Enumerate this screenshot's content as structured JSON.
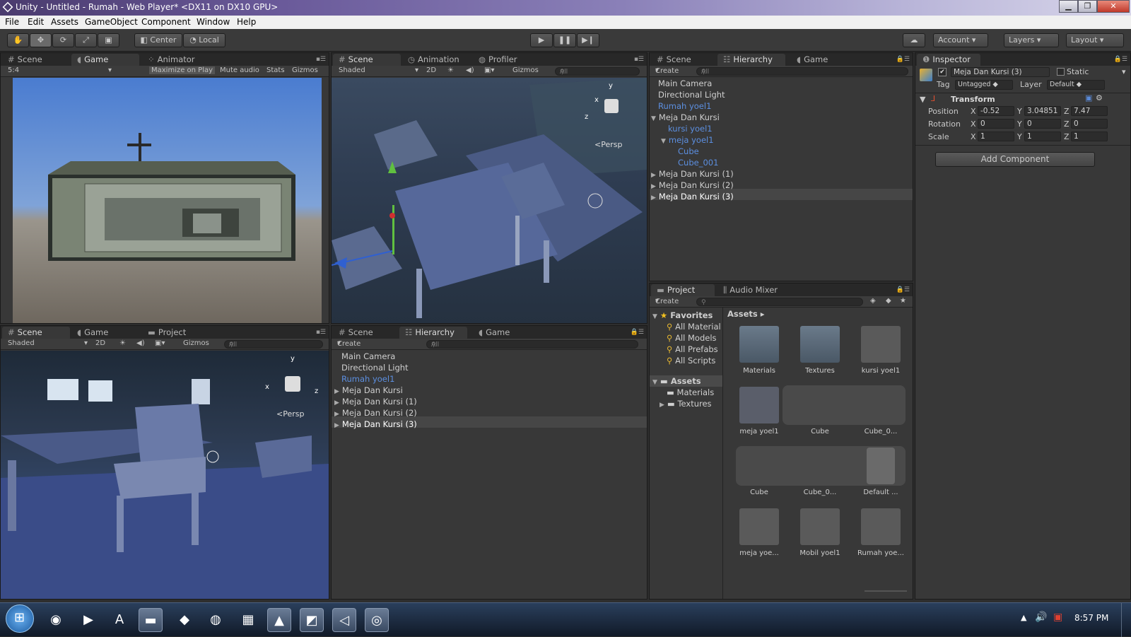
{
  "window": {
    "title": "Unity - Untitled - Rumah - Web Player* <DX11 on DX10 GPU>",
    "min": "▁",
    "max": "❐",
    "close": "✕"
  },
  "menu": [
    "File",
    "Edit",
    "Assets",
    "GameObject",
    "Component",
    "Window",
    "Help"
  ],
  "toolbar": {
    "pivot": "Center",
    "space": "Local",
    "account": "Account",
    "layers": "Layers",
    "layout": "Layout"
  },
  "game_panel": {
    "tabs": [
      "Scene",
      "Game",
      "Animator"
    ],
    "aspect": "5:4",
    "maximize": "Maximize on Play",
    "mute": "Mute audio",
    "stats": "Stats",
    "gizmos": "Gizmos"
  },
  "scene_top": {
    "tabs": [
      "Scene",
      "Animation",
      "Profiler"
    ],
    "shading": "Shaded",
    "mode2d": "2D",
    "gizmos": "Gizmos",
    "search": "All",
    "persp": "Persp",
    "axis_y": "y",
    "axis_x": "x",
    "axis_z": "z"
  },
  "hierarchy_top": {
    "tabs": [
      "Scene",
      "Hierarchy",
      "Game"
    ],
    "create": "Create",
    "search": "All",
    "items": [
      {
        "label": "Main Camera",
        "depth": 0,
        "arrow": "",
        "blue": false
      },
      {
        "label": "Directional Light",
        "depth": 0,
        "arrow": "",
        "blue": false
      },
      {
        "label": "Rumah yoel1",
        "depth": 0,
        "arrow": "",
        "blue": true
      },
      {
        "label": "Meja Dan Kursi",
        "depth": 0,
        "arrow": "▼",
        "blue": false
      },
      {
        "label": "kursi yoel1",
        "depth": 1,
        "arrow": "",
        "blue": true
      },
      {
        "label": "meja yoel1",
        "depth": 1,
        "arrow": "▼",
        "blue": true
      },
      {
        "label": "Cube",
        "depth": 2,
        "arrow": "",
        "blue": true
      },
      {
        "label": "Cube_001",
        "depth": 2,
        "arrow": "",
        "blue": true
      },
      {
        "label": "Meja Dan Kursi (1)",
        "depth": 0,
        "arrow": "▶",
        "blue": false
      },
      {
        "label": "Meja Dan Kursi (2)",
        "depth": 0,
        "arrow": "▶",
        "blue": false
      },
      {
        "label": "Meja Dan Kursi (3)",
        "depth": 0,
        "arrow": "▶",
        "blue": false,
        "selected": true
      }
    ]
  },
  "inspector": {
    "tab": "Inspector",
    "object_name": "Meja Dan Kursi (3)",
    "static": "Static",
    "tag_label": "Tag",
    "tag_value": "Untagged",
    "layer_label": "Layer",
    "layer_value": "Default",
    "transform": "Transform",
    "position_label": "Position",
    "rotation_label": "Rotation",
    "scale_label": "Scale",
    "position": {
      "x": "-0.52",
      "y": "3.04851",
      "z": "7.47"
    },
    "rotation": {
      "x": "0",
      "y": "0",
      "z": "0"
    },
    "scale": {
      "x": "1",
      "y": "1",
      "z": "1"
    },
    "axis_x": "X",
    "axis_y": "Y",
    "axis_z": "Z",
    "add_component": "Add Component"
  },
  "scene_bottom": {
    "tabs": [
      "Scene",
      "Game",
      "Project"
    ],
    "shading": "Shaded",
    "mode2d": "2D",
    "gizmos": "Gizmos",
    "search": "All",
    "persp": "Persp",
    "axis_y": "y",
    "axis_x": "x",
    "axis_z": "z"
  },
  "hierarchy_bottom": {
    "tabs": [
      "Scene",
      "Hierarchy",
      "Game"
    ],
    "create": "Create",
    "search": "All",
    "items": [
      {
        "label": "Main Camera",
        "arrow": "",
        "blue": false
      },
      {
        "label": "Directional Light",
        "arrow": "",
        "blue": false
      },
      {
        "label": "Rumah yoel1",
        "arrow": "",
        "blue": true
      },
      {
        "label": "Meja Dan Kursi",
        "arrow": "▶",
        "blue": false
      },
      {
        "label": "Meja Dan Kursi (1)",
        "arrow": "▶",
        "blue": false
      },
      {
        "label": "Meja Dan Kursi (2)",
        "arrow": "▶",
        "blue": false
      },
      {
        "label": "Meja Dan Kursi (3)",
        "arrow": "▶",
        "blue": false,
        "selected": true
      }
    ]
  },
  "project": {
    "tabs": [
      "Project",
      "Audio Mixer"
    ],
    "create": "Create",
    "favorites": "Favorites",
    "fav_items": [
      "All Material",
      "All Models",
      "All Prefabs",
      "All Scripts"
    ],
    "assets": "Assets",
    "folders": [
      "Materials",
      "Textures"
    ],
    "breadcrumb": "Assets",
    "grid": [
      {
        "label": "Materials",
        "kind": "folder"
      },
      {
        "label": "Textures",
        "kind": "folder"
      },
      {
        "label": "kursi yoel1",
        "kind": "model"
      },
      {
        "label": "meja yoel1",
        "kind": "model"
      },
      {
        "label": "Cube",
        "kind": "mesh"
      },
      {
        "label": "Cube_0...",
        "kind": "mesh"
      },
      {
        "label": "Cube",
        "kind": "mesh2"
      },
      {
        "label": "Cube_0...",
        "kind": "cube"
      },
      {
        "label": "Default ...",
        "kind": "anim"
      },
      {
        "label": "meja yoe...",
        "kind": "avatar"
      },
      {
        "label": "Mobil yoel1",
        "kind": "car"
      },
      {
        "label": "Rumah yoe...",
        "kind": "house"
      }
    ]
  },
  "taskbar": {
    "time": "8:57 PM"
  },
  "colors": {
    "editor_bg": "#383838",
    "prefab_blue": "#5c8fe0",
    "selection": "#464646"
  }
}
